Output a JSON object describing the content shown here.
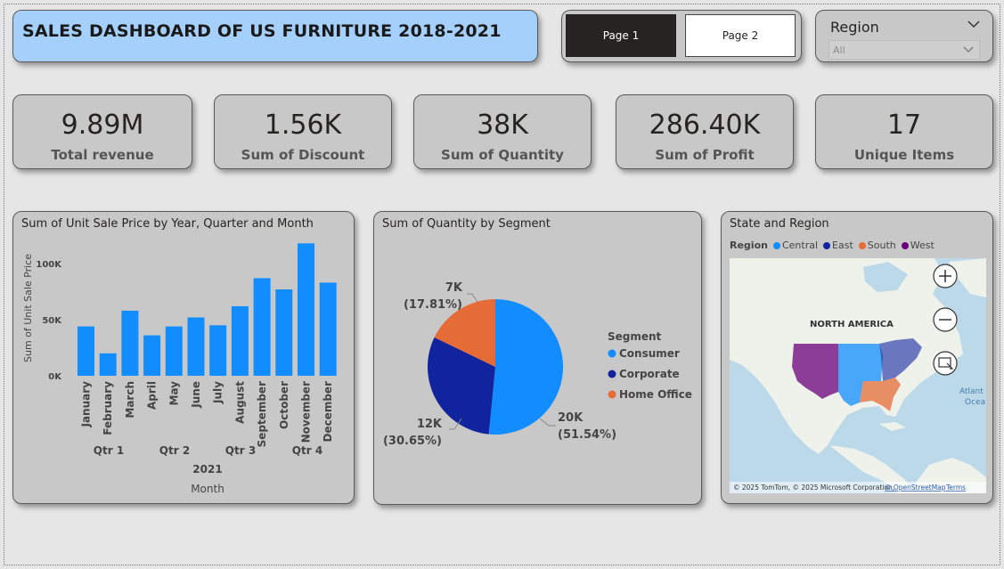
{
  "title": "SALES DASHBOARD OF US FURNITURE 2018-2021",
  "nav": {
    "page1": "Page 1",
    "page2": "Page 2"
  },
  "slicer": {
    "title": "Region",
    "value": "All"
  },
  "kpis": [
    {
      "value": "9.89M",
      "label": "Total revenue"
    },
    {
      "value": "1.56K",
      "label": "Sum of Discount"
    },
    {
      "value": "38K",
      "label": "Sum of Quantity"
    },
    {
      "value": "286.40K",
      "label": "Sum of Profit"
    },
    {
      "value": "17",
      "label": "Unique Items"
    }
  ],
  "bar_chart": {
    "title": "Sum of Unit Sale Price by Year, Quarter and Month",
    "ylabel": "Sum of Unit Sale Price",
    "xlabel": "Month",
    "year": "2021",
    "quarters": [
      "Qtr 1",
      "Qtr 2",
      "Qtr 3",
      "Qtr 4"
    ],
    "ticks": [
      "0K",
      "50K",
      "100K"
    ]
  },
  "pie_chart": {
    "title": "Sum of Quantity by Segment",
    "legend_title": "Segment",
    "labels": [
      {
        "value": "20K",
        "pct": "(51.54%)"
      },
      {
        "value": "12K",
        "pct": "(30.65%)"
      },
      {
        "value": "7K",
        "pct": "(17.81%)"
      }
    ]
  },
  "map": {
    "title": "State and Region",
    "legend_title": "Region",
    "regions": [
      {
        "name": "Central",
        "color": "#118dff"
      },
      {
        "name": "East",
        "color": "#12239e"
      },
      {
        "name": "South",
        "color": "#e66c37"
      },
      {
        "name": "West",
        "color": "#6b007b"
      }
    ],
    "continent_label": "NORTH AMERICA",
    "ocean_label_1": "Atlant",
    "ocean_label_2": "Ocea",
    "copyright": "© 2025 TomTom, © 2025 Microsoft Corporation,",
    "osm_link": "© OpenStreetMap",
    "terms": "Terms"
  },
  "chart_data": [
    {
      "type": "bar",
      "title": "Sum of Unit Sale Price by Year, Quarter and Month",
      "categories": [
        "January",
        "February",
        "March",
        "April",
        "May",
        "June",
        "July",
        "August",
        "September",
        "October",
        "November",
        "December"
      ],
      "values": [
        44000,
        20000,
        58000,
        36000,
        44000,
        52000,
        45000,
        62000,
        87000,
        77000,
        118000,
        83000
      ],
      "xlabel": "Month",
      "ylabel": "Sum of Unit Sale Price",
      "ylim": [
        0,
        125000
      ],
      "color": "#118dff"
    },
    {
      "type": "pie",
      "title": "Sum of Quantity by Segment",
      "categories": [
        "Consumer",
        "Corporate",
        "Home Office"
      ],
      "values": [
        51.54,
        30.65,
        17.81
      ],
      "colors": [
        "#118dff",
        "#12239e",
        "#e66c37"
      ]
    }
  ]
}
